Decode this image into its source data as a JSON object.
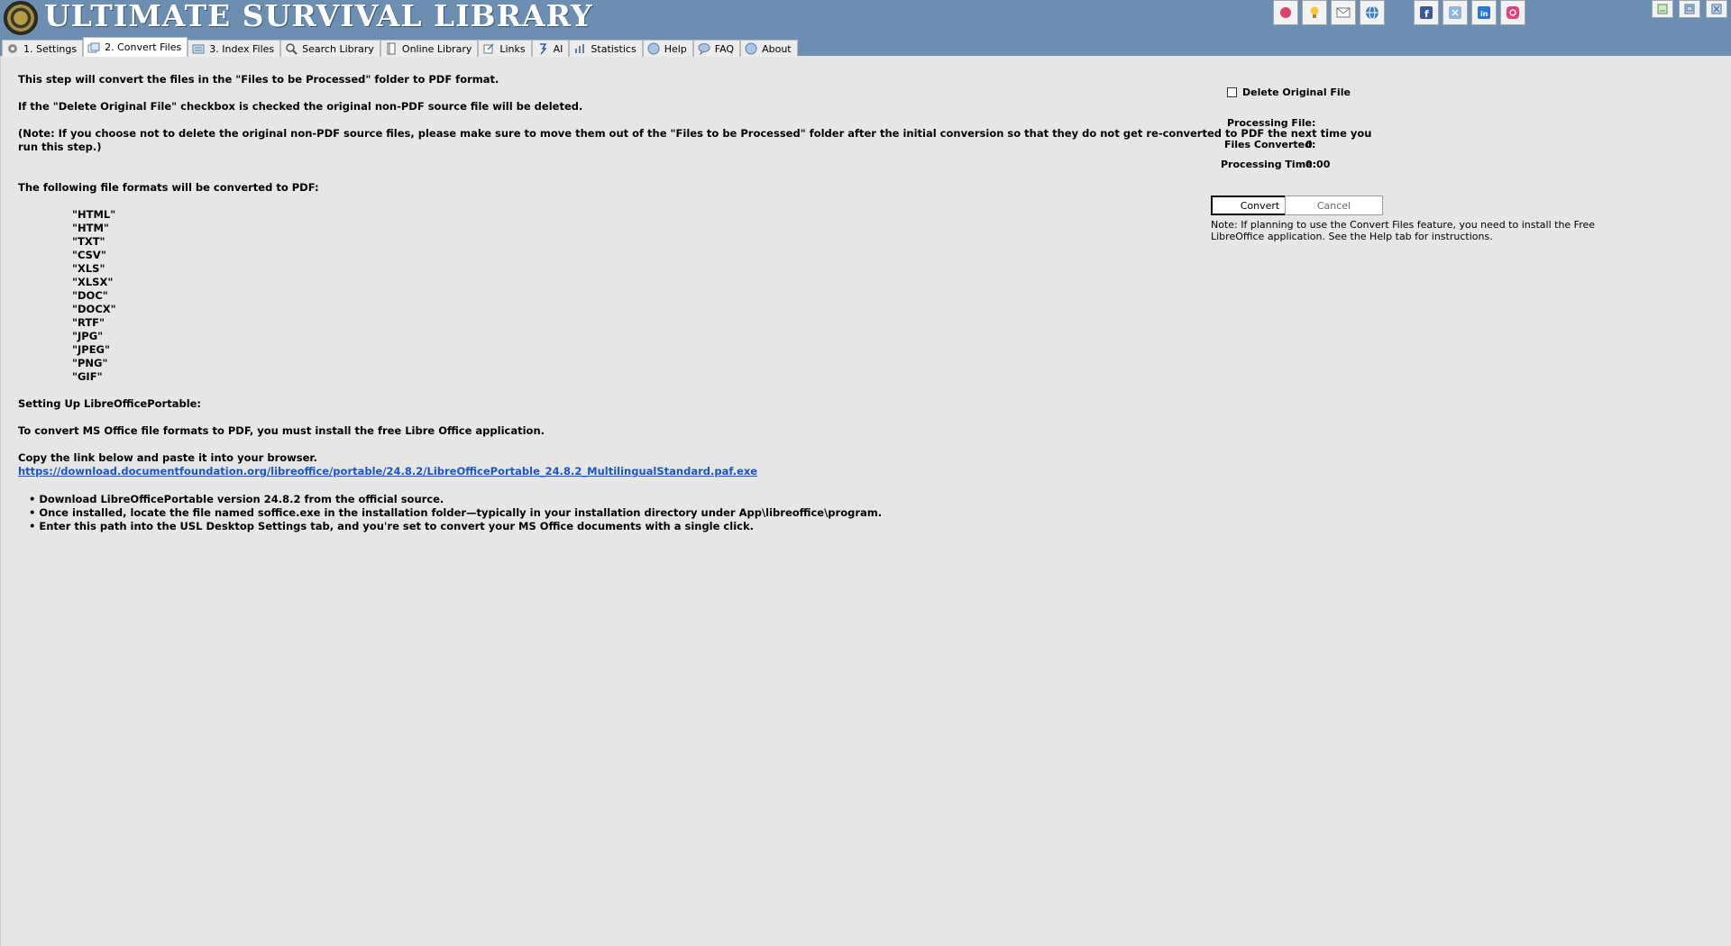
{
  "header": {
    "title": "ULTIMATE SURVIVAL LIBRARY",
    "logo": "emblem-icon",
    "buttons": [
      {
        "icon": "record-icon"
      },
      {
        "icon": "lightbulb-icon"
      },
      {
        "icon": "envelope-icon"
      },
      {
        "icon": "globe-icon"
      },
      {
        "icon": "facebook-icon"
      },
      {
        "icon": "x-icon"
      },
      {
        "icon": "linkedin-icon"
      },
      {
        "icon": "instagram-icon"
      }
    ],
    "window_buttons": [
      {
        "icon": "minimize-icon"
      },
      {
        "icon": "maximize-icon"
      },
      {
        "icon": "close-icon"
      }
    ]
  },
  "tabs": [
    {
      "label": "1. Settings",
      "icon": "gear-icon"
    },
    {
      "label": "2. Convert Files",
      "icon": "convert-icon",
      "active": true
    },
    {
      "label": "3. Index Files",
      "icon": "index-icon"
    },
    {
      "label": "Search Library",
      "icon": "search-icon"
    },
    {
      "label": "Online Library",
      "icon": "book-icon"
    },
    {
      "label": "Links",
      "icon": "link-icon"
    },
    {
      "label": "AI",
      "icon": "ai-icon"
    },
    {
      "label": "Statistics",
      "icon": "chart-icon"
    },
    {
      "label": "Help",
      "icon": "help-icon"
    },
    {
      "label": "FAQ",
      "icon": "faq-icon"
    },
    {
      "label": "About",
      "icon": "info-icon"
    }
  ],
  "main": {
    "intro": "This step will convert the files in the \"Files to be Processed\" folder to PDF format.",
    "delete_info": "If the \"Delete Original File\" checkbox is checked the original non-PDF source file will be deleted.",
    "note_line1": "(Note: If you choose not to delete the original non-PDF source files, please make sure to move them out of the \"Files to be Processed\" folder after the initial conversion so that they do not get re-converted to PDF the next time you",
    "note_line2": "run this step.)",
    "formats_heading": "The following file formats will be converted to PDF:",
    "formats": [
      "\"HTML\"",
      "\"HTM\"",
      "\"TXT\"",
      "\"CSV\"",
      "\"XLS\"",
      "\"XLSX\"",
      "\"DOC\"",
      "\"DOCX\"",
      "\"RTF\"",
      "\"JPG\"",
      "\"JPEG\"",
      "\"PNG\"",
      "\"GIF\""
    ],
    "setup_heading": "Setting Up LibreOfficePortable:",
    "setup_text": "To convert MS Office file formats to PDF, you must install the free Libre Office application.",
    "copy_text": "Copy the link below and paste it into your browser.",
    "link": "https://download.documentfoundation.org/libreoffice/portable/24.8.2/LibreOfficePortable_24.8.2_MultilingualStandard.paf.exe",
    "bullets": [
      "Download LibreOfficePortable version 24.8.2 from the official source.",
      "Once installed, locate the file named soffice.exe in the installation folder—typically in your installation directory under App\\libreoffice\\program.",
      "Enter this path into the USL Desktop Settings tab, and you're set to convert your MS Office documents with a single click."
    ]
  },
  "panel": {
    "delete_label": "Delete Original File",
    "delete_checked": false,
    "processing_file_label": "Processing File:",
    "processing_file_value": "",
    "files_converted_label": "Files Converted:",
    "files_converted_value": "0",
    "processing_time_label": "Processing Time:",
    "processing_time_value": "0:00",
    "convert_label": "Convert",
    "cancel_label": "Cancel",
    "note": "Note: If planning to use the Convert Files feature, you need to install the Free LibreOffice application. See the Help tab for instructions."
  },
  "colors": {
    "header_bg": "#6c8eb0",
    "page_bg": "#e6e6e6",
    "link": "#1a56c8"
  }
}
